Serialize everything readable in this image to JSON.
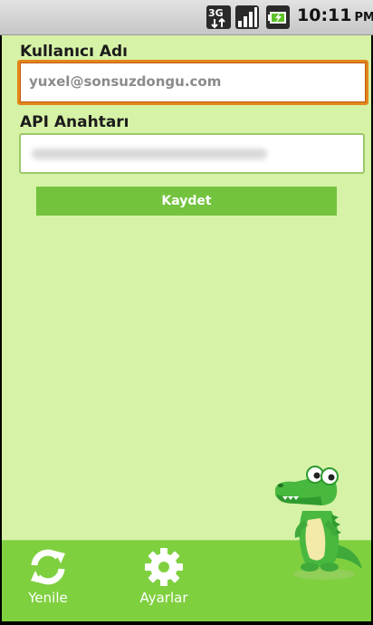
{
  "status_bar": {
    "network": "3G",
    "time": "10:11",
    "ampm": "PM"
  },
  "form": {
    "username_label": "Kullanıcı Adı",
    "username_value": "yuxel@sonsuzdongu.com",
    "api_key_label": "API Anahtarı",
    "save_label": "Kaydet"
  },
  "toolbar": {
    "refresh_label": "Yenile",
    "refresh_icon": "refresh-icon",
    "settings_label": "Ayarlar",
    "settings_icon": "gear-icon"
  },
  "colors": {
    "background": "#d6f2a6",
    "accent": "#74c33e",
    "toolbar": "#7fd03f",
    "focus_border": "#e2861c"
  }
}
